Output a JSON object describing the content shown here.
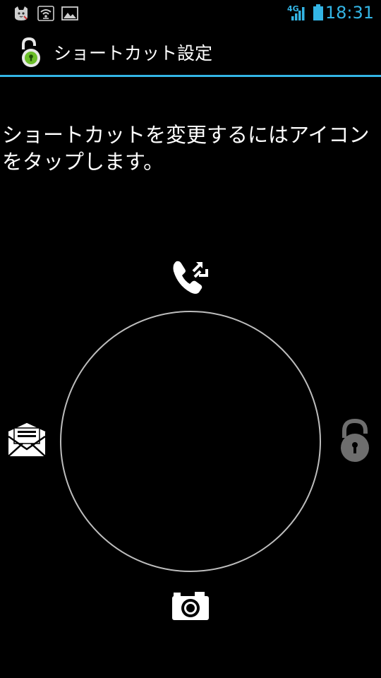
{
  "status_bar": {
    "time": "18:31",
    "network": "4G",
    "icons": [
      "cat-app-icon",
      "wifi-usb-icon",
      "gallery-icon",
      "signal-icon",
      "battery-icon"
    ]
  },
  "action_bar": {
    "title": "ショートカット設定",
    "icon": "unlock-icon",
    "accent_color": "#33b5e5"
  },
  "instruction": "ショートカットを変更するにはアイコンをタップします。",
  "shortcuts": {
    "top": "phone-forward-icon",
    "left": "mail-icon",
    "right": "lock-icon",
    "bottom": "camera-icon"
  }
}
